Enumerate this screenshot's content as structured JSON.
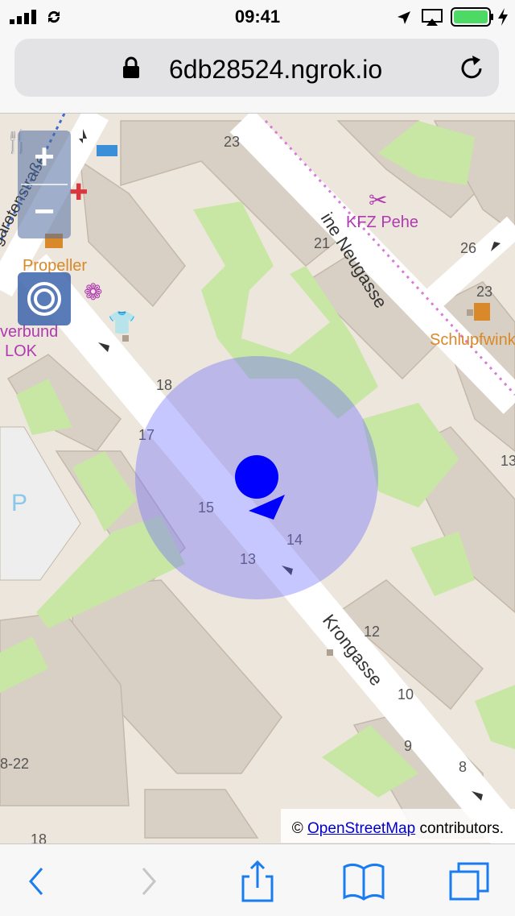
{
  "status_bar": {
    "time": "09:41",
    "icons": [
      "signal-icon",
      "sync-icon",
      "location-arrow-icon",
      "airplay-icon",
      "battery-icon",
      "charging-icon"
    ]
  },
  "browser": {
    "url": "6db28524.ngrok.io",
    "lock_icon": "lock-icon",
    "reload_icon": "reload-icon"
  },
  "map": {
    "streets": [
      "Krongasse",
      "ine Neugasse",
      "garetenstraße"
    ],
    "pois": [
      "KFZ Pehe",
      "Propeller",
      "Schlupfwinkl",
      "verbund",
      "LOK"
    ],
    "house_numbers": [
      "23",
      "21",
      "26",
      "23",
      "18",
      "17",
      "15",
      "14",
      "13",
      "12",
      "10",
      "9",
      "8",
      "8-22",
      "18",
      "13"
    ],
    "parking_label": "P",
    "controls": {
      "zoom_in": "+",
      "zoom_out": "−"
    },
    "colors": {
      "accuracy_circle": "#6b6bff",
      "position_marker": "#0000ff",
      "green": "#c8e6a4",
      "road": "#ffffff",
      "building": "#d9d0c5"
    }
  },
  "attribution": {
    "prefix": "©",
    "link": "OpenStreetMap",
    "suffix": "contributors."
  },
  "toolbar": {
    "icons": [
      "back-icon",
      "forward-icon",
      "share-icon",
      "bookmarks-icon",
      "tabs-icon"
    ]
  }
}
